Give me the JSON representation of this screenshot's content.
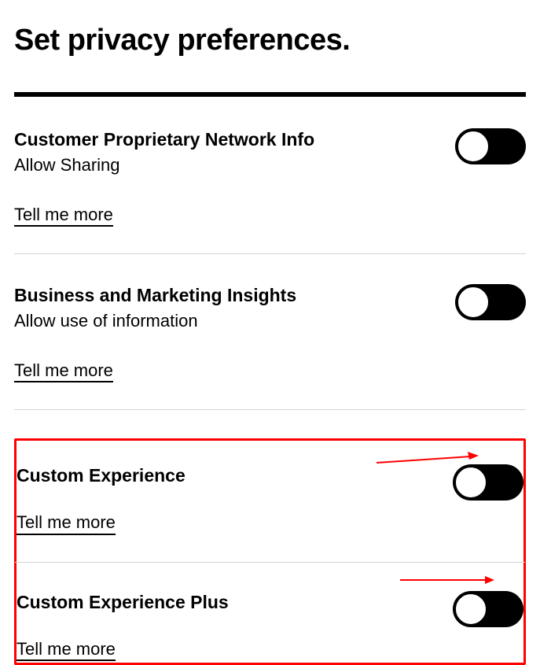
{
  "page": {
    "title": "Set privacy preferences."
  },
  "sections": [
    {
      "heading": "Customer Proprietary Network Info",
      "subtext": "Allow Sharing",
      "more_label": "Tell me more",
      "toggle_on": true
    },
    {
      "heading": "Business and Marketing Insights",
      "subtext": "Allow use of information",
      "more_label": "Tell me more",
      "toggle_on": true
    },
    {
      "heading": "Custom Experience",
      "subtext": "",
      "more_label": "Tell me more",
      "toggle_on": true
    },
    {
      "heading": "Custom Experience Plus",
      "subtext": "",
      "more_label": "Tell me more",
      "toggle_on": true
    }
  ],
  "annotation": {
    "highlight_color": "#ff0000"
  }
}
